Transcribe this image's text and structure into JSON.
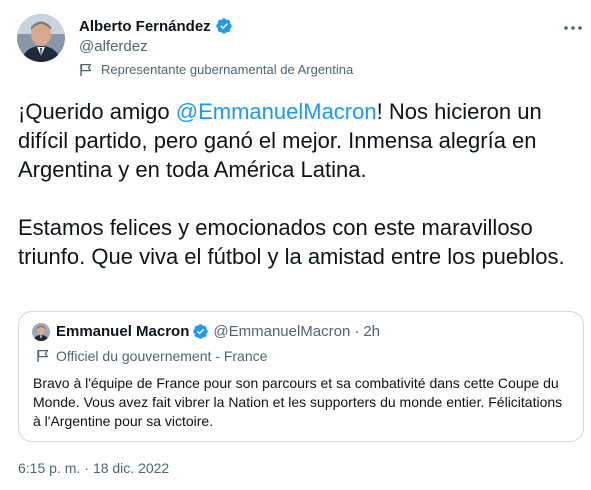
{
  "tweet": {
    "author_name": "Alberto Fernández",
    "author_handle": "@alferdez",
    "author_label": "Representante gubernamental de Argentina",
    "text_intro": "¡Querido amigo ",
    "mention": "@EmmanuelMacron",
    "text_rest": "! Nos hicieron un difícil partido, pero ganó el mejor. Inmensa alegría en Argentina y en toda América Latina.",
    "text_paragraph2": "Estamos felices y emocionados con este maravilloso triunfo. Que viva el fútbol y la amistad entre los pueblos.",
    "time": "6:15 p. m.",
    "separator": "·",
    "date": "18 dic. 2022"
  },
  "quote": {
    "author_name": "Emmanuel Macron",
    "author_handle": "@EmmanuelMacron",
    "separator": "·",
    "time": "2h",
    "author_label": "Officiel du gouvernement - France",
    "text": "Bravo à l'équipe de France pour son parcours et sa combativité dans cette Coupe du Monde. Vous avez fait vibrer la Nation et les supporters du monde entier. Félicitations à l'Argentine pour sa victoire."
  },
  "icons": {
    "verified": "verified-badge-icon",
    "more": "more-horizontal-icon",
    "label": "flag-icon"
  },
  "colors": {
    "link": "#1d9bf0",
    "secondary_text": "#536471",
    "primary_text": "#0f1419",
    "border": "#cfd9de"
  }
}
